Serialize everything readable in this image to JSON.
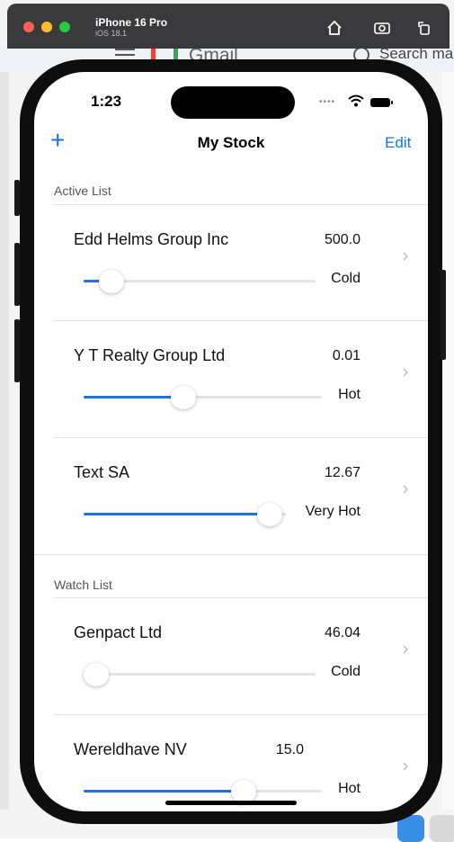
{
  "simulator": {
    "device_name": "iPhone 16 Pro",
    "os_version": "iOS 18.1",
    "buttons": [
      "home-icon",
      "screenshot-icon",
      "rotate-icon"
    ]
  },
  "background": {
    "gmail_text": "Gmail",
    "search_text": "Search ma"
  },
  "status_bar": {
    "time": "1:23"
  },
  "nav": {
    "add_label": "+",
    "title": "My Stock",
    "edit_label": "Edit"
  },
  "active_list": {
    "header": "Active List",
    "items": [
      {
        "name": "Edd Helms Group Inc",
        "price": "500.0",
        "heat": "Cold",
        "level": 0.12
      },
      {
        "name": "Y T Realty Group Ltd",
        "price": "0.01",
        "heat": "Hot",
        "level": 0.42
      },
      {
        "name": "Text SA",
        "price": "12.67",
        "heat": "Very Hot",
        "level": 0.92
      }
    ]
  },
  "watch_list": {
    "header": "Watch List",
    "items": [
      {
        "name": "Genpact Ltd",
        "price": "46.04",
        "heat": "Cold",
        "level": 0.0
      },
      {
        "name": "Wereldhave NV",
        "price": "15.0",
        "heat": "Hot",
        "level": 0.67
      }
    ]
  },
  "colors": {
    "accent": "#1a73e8",
    "track": "#e3e3e8"
  }
}
